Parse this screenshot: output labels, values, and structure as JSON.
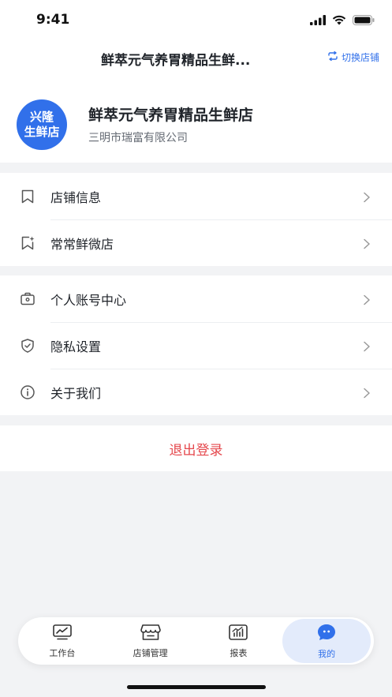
{
  "status_bar": {
    "time": "9:41"
  },
  "nav": {
    "title": "鲜萃元气养胃精品生鲜...",
    "switch_store_label": "切换店铺"
  },
  "store": {
    "avatar_line1": "兴隆",
    "avatar_line2": "生鲜店",
    "name": "鲜萃元气养胃精品生鲜店",
    "company": "三明市瑞富有限公司"
  },
  "menu_group_1": [
    {
      "label": "店铺信息",
      "icon": "bookmark-icon"
    },
    {
      "label": "常常鲜微店",
      "icon": "sparkle-bookmark-icon"
    }
  ],
  "menu_group_2": [
    {
      "label": "个人账号中心",
      "icon": "id-card-icon"
    },
    {
      "label": "隐私设置",
      "icon": "shield-check-icon"
    },
    {
      "label": "关于我们",
      "icon": "info-circle-icon"
    }
  ],
  "logout_label": "退出登录",
  "tabs": [
    {
      "label": "工作台",
      "icon": "chart-monitor-icon",
      "active": false
    },
    {
      "label": "店铺管理",
      "icon": "storefront-icon",
      "active": false
    },
    {
      "label": "报表",
      "icon": "bar-chart-icon",
      "active": false
    },
    {
      "label": "我的",
      "icon": "chat-bubble-icon",
      "active": true
    }
  ],
  "colors": {
    "accent": "#3170ea",
    "logout": "#e5484d",
    "background": "#f2f3f5"
  }
}
